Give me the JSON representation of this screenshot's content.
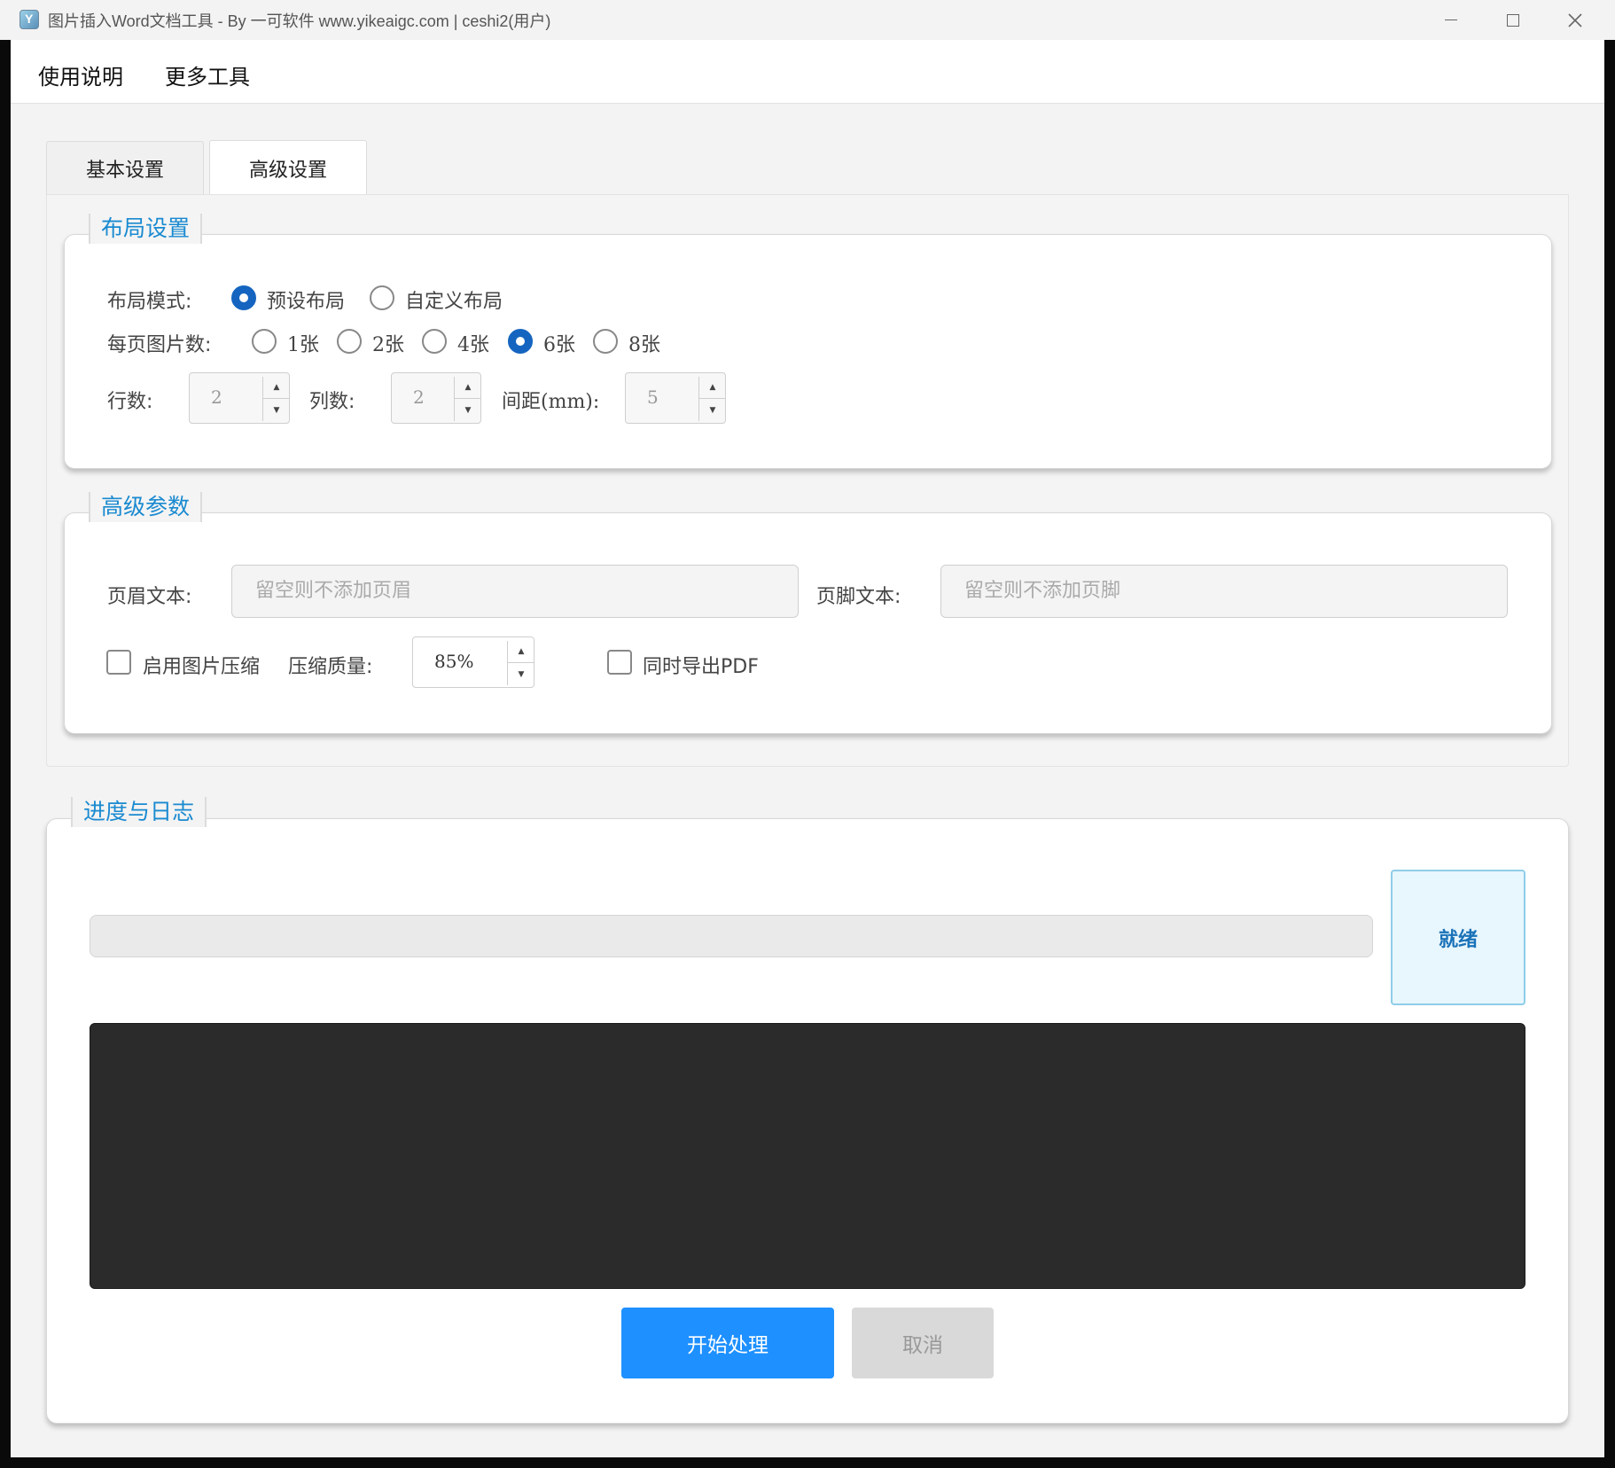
{
  "window": {
    "title": "图片插入Word文档工具 - By 一可软件 www.yikeaigc.com | ceshi2(用户)"
  },
  "menu": {
    "help": "使用说明",
    "tools": "更多工具"
  },
  "tabs": [
    {
      "label": "基本设置",
      "active": false
    },
    {
      "label": "高级设置",
      "active": true
    }
  ],
  "layout_group": {
    "title": "布局设置",
    "mode_label": "布局模式:",
    "mode_options": [
      {
        "label": "预设布局",
        "checked": true
      },
      {
        "label": "自定义布局",
        "checked": false
      }
    ],
    "per_page_label": "每页图片数:",
    "per_page_options": [
      {
        "label": "1张",
        "checked": false
      },
      {
        "label": "2张",
        "checked": false
      },
      {
        "label": "4张",
        "checked": false
      },
      {
        "label": "6张",
        "checked": true
      },
      {
        "label": "8张",
        "checked": false
      }
    ],
    "rows_label": "行数:",
    "rows_value": "2",
    "cols_label": "列数:",
    "cols_value": "2",
    "spacing_label": "间距(mm):",
    "spacing_value": "5"
  },
  "advanced_group": {
    "title": "高级参数",
    "header_label": "页眉文本:",
    "header_placeholder": "留空则不添加页眉",
    "footer_label": "页脚文本:",
    "footer_placeholder": "留空则不添加页脚",
    "compress_label": "启用图片压缩",
    "compress_checked": false,
    "quality_label": "压缩质量:",
    "quality_value": "85%",
    "pdf_label": "同时导出PDF",
    "pdf_checked": false
  },
  "progress_group": {
    "title": "进度与日志",
    "progress": 0,
    "status": "就绪",
    "log": ""
  },
  "actions": {
    "start": "开始处理",
    "cancel": "取消"
  },
  "colors": {
    "accent": "#1e90ff",
    "group_title": "#1a8ad0",
    "radio_checked": "#1565c0",
    "log_bg": "#2b2b2b",
    "status_bg": "#e8f6fd"
  }
}
